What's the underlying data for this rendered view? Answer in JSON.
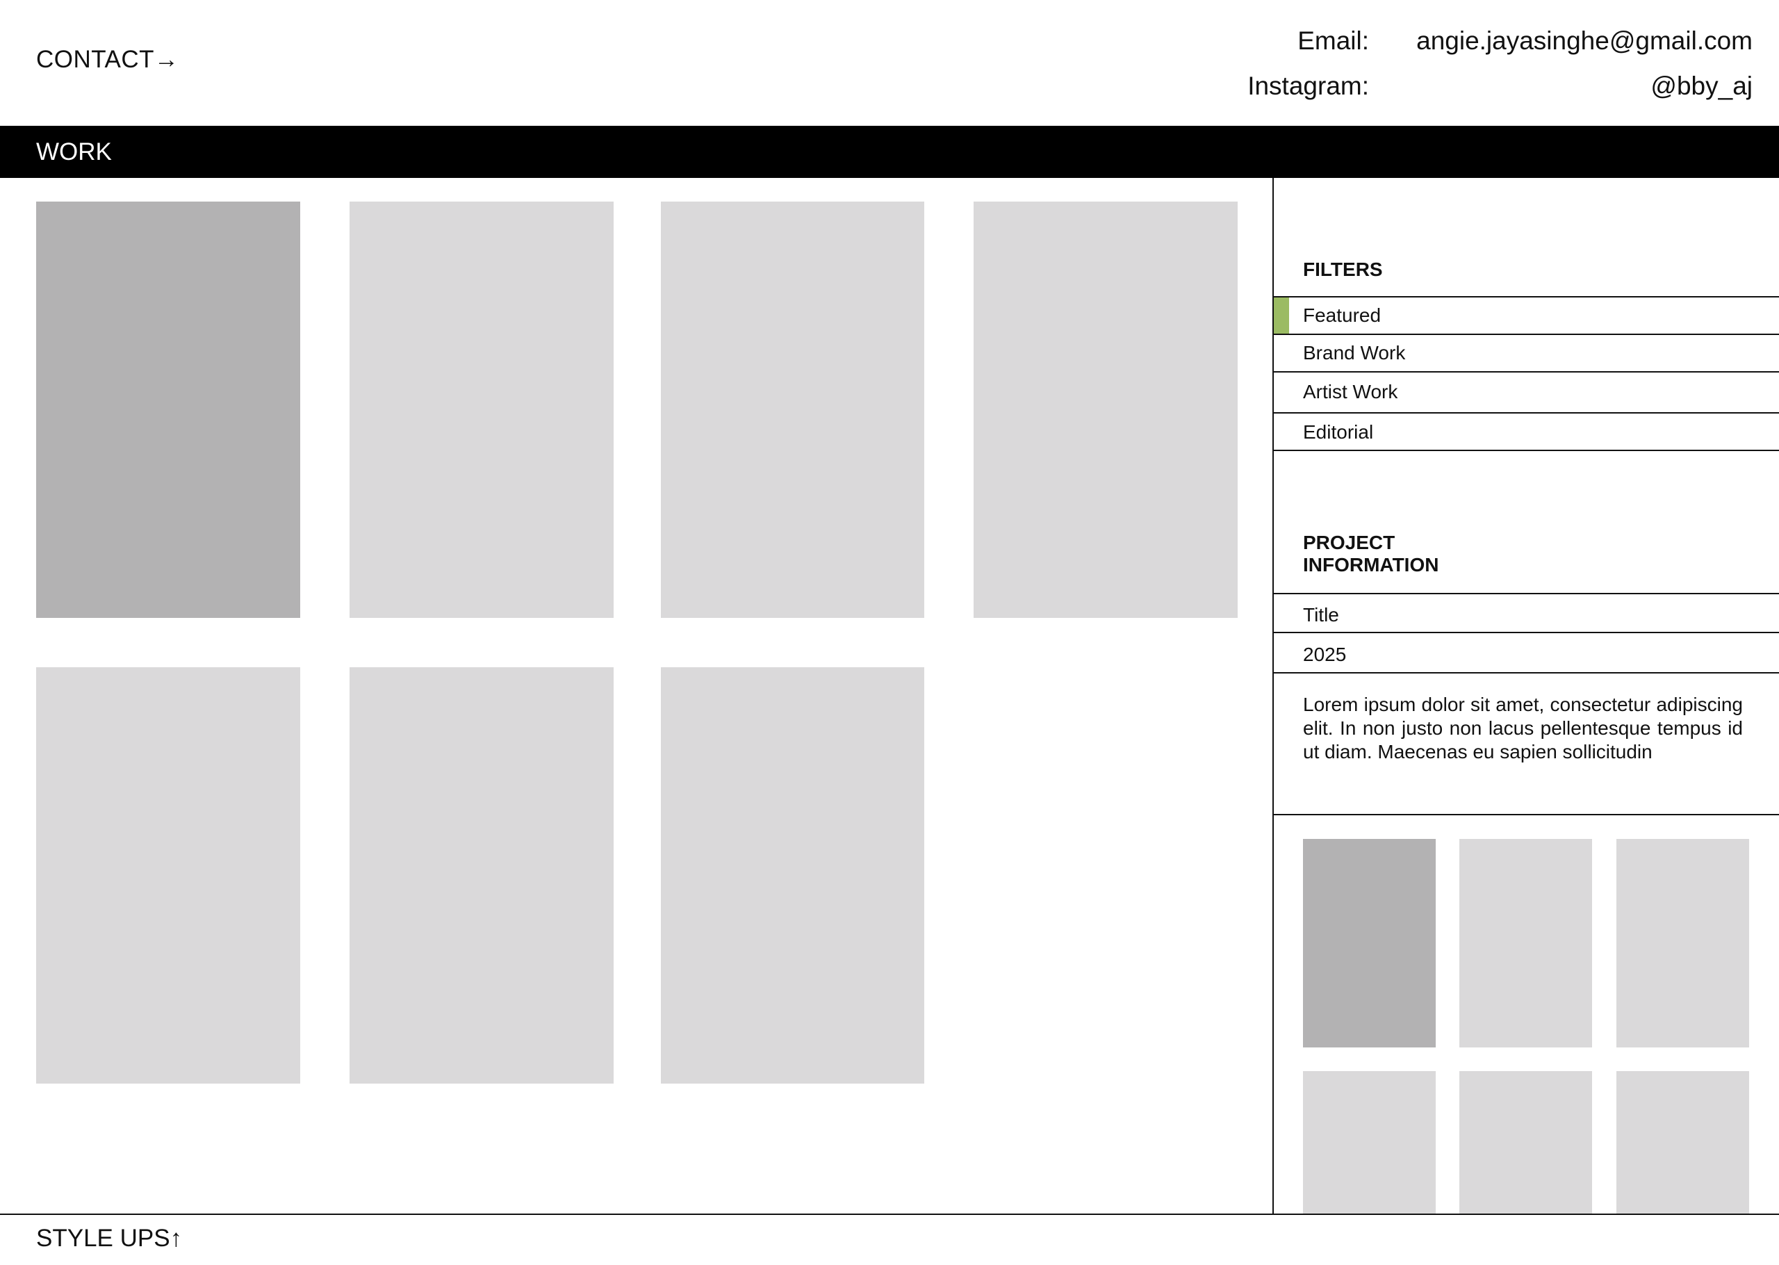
{
  "header": {
    "contact_link": "CONTACT→",
    "contacts": [
      {
        "label": "Email:",
        "value": "angie.jayasinghe@gmail.com"
      },
      {
        "label": "Instagram:",
        "value": "@bby_aj"
      }
    ]
  },
  "work": {
    "title": "WORK",
    "tiles_count": 7,
    "active_tile": 1
  },
  "filters": {
    "heading": "FILTERS",
    "items": [
      {
        "label": "Featured",
        "selected": true
      },
      {
        "label": "Brand Work",
        "selected": false
      },
      {
        "label": "Artist Work",
        "selected": false
      },
      {
        "label": "Editorial",
        "selected": false
      }
    ]
  },
  "project": {
    "heading_line1": "PROJECT",
    "heading_line2": "INFORMATION",
    "title": "Title",
    "year": "2025",
    "description": "Lorem ipsum dolor sit amet, consectetur adipiscing elit. In non justo non lacus pellentesque tempus id ut diam. Maecenas eu sapien sollicitudin",
    "thumbnails_count": 6,
    "active_thumbnail": 1
  },
  "footer": {
    "link": "STYLE UPS↑"
  },
  "colors": {
    "accent": "#9bbb63",
    "tile": "#dad9da",
    "tile_active": "#b3b2b3",
    "bar": "#000000"
  }
}
